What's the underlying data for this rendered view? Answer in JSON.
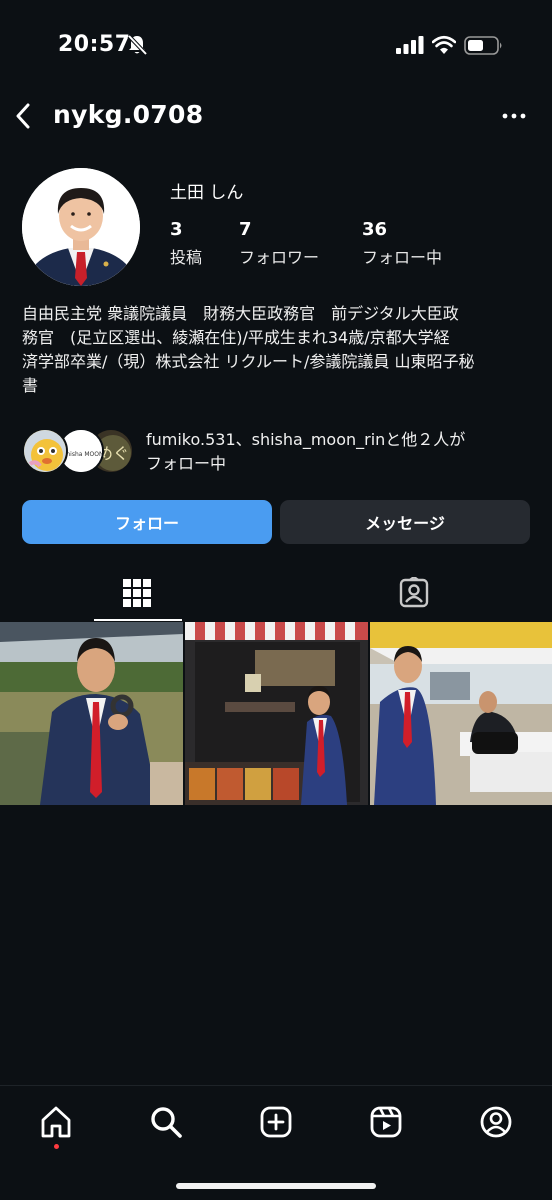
{
  "status_bar": {
    "time": "20:57"
  },
  "header": {
    "username": "nykg.0708"
  },
  "profile": {
    "display_name": "土田 しん",
    "stats": [
      {
        "count": "3",
        "label": "投稿"
      },
      {
        "count": "7",
        "label": "フォロワー"
      },
      {
        "count": "36",
        "label": "フォロー中"
      }
    ],
    "bio_lines": [
      "自由民主党 衆議院議員　財務大臣政務官　前デジタル大臣政",
      "務官　(足立区選出、綾瀬在住)/平成生まれ34歳/京都大学経",
      "済学部卒業/（現）株式会社 リクルート/参議院議員 山東昭子秘",
      "書"
    ],
    "followed_by_lines": [
      "fumiko.531、shisha_moon_rinと他２人が",
      "フォロー中"
    ],
    "followed_avatar_text": "Shisha MOON"
  },
  "actions": {
    "follow_label": "フォロー",
    "message_label": "メッセージ"
  },
  "tabs": [
    {
      "name": "grid-icon",
      "active": true
    },
    {
      "name": "tagged-icon",
      "active": false
    }
  ],
  "posts": [
    {
      "name": "post-man-holding-object-outdoors"
    },
    {
      "name": "post-man-at-food-truck"
    },
    {
      "name": "post-man-under-tent"
    }
  ],
  "bottom_nav": [
    {
      "name": "home-icon",
      "dot": true
    },
    {
      "name": "search-icon",
      "dot": false
    },
    {
      "name": "create-icon",
      "dot": false
    },
    {
      "name": "reels-icon",
      "dot": false
    },
    {
      "name": "profile-icon",
      "dot": false
    }
  ],
  "colors": {
    "background": "#0c1014",
    "follow_button": "#4a9cf1",
    "message_button": "#262a30",
    "notification_dot": "#ff3b40"
  }
}
